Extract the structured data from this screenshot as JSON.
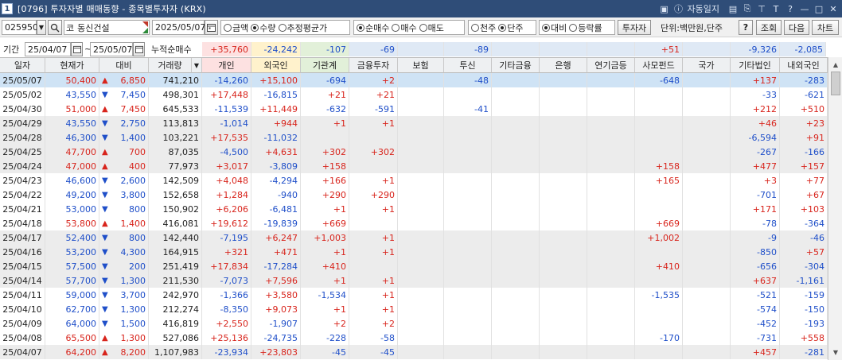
{
  "window": {
    "number": "1",
    "title": "[0796] 투자자별 매매동향 - 종목별투자자 (KRX)",
    "auto_login": "자동일지"
  },
  "toolbar": {
    "code": "025950",
    "market_badge": "코",
    "stock_name": "동신건설",
    "date": "2025/05/07",
    "unit_label": "단위:백만원,단주",
    "help": "?",
    "lookup": "조회",
    "next": "다음",
    "chart": "차트",
    "investor_btn": "투자자",
    "value_radios": [
      {
        "label": "금액",
        "checked": false
      },
      {
        "label": "수량",
        "checked": true
      },
      {
        "label": "추정평균가",
        "checked": false
      }
    ],
    "trade_radios": [
      {
        "label": "순매수",
        "checked": true
      },
      {
        "label": "매수",
        "checked": false
      },
      {
        "label": "매도",
        "checked": false
      }
    ],
    "unit_radios": [
      {
        "label": "천주",
        "checked": false
      },
      {
        "label": "단주",
        "checked": true
      }
    ],
    "compare_radios": [
      {
        "label": "대비",
        "checked": true
      },
      {
        "label": "등락률",
        "checked": false
      }
    ]
  },
  "period": {
    "label": "기간",
    "from": "25/04/07",
    "to": "25/05/07",
    "cum_label": "누적순매수",
    "tilde": "~"
  },
  "cumulative": {
    "개인": "+35,760",
    "외국인": "-24,242",
    "기관계": "-107",
    "금융투자": "-69",
    "보험": "",
    "투신": "-89",
    "기타금융": "",
    "은행": "",
    "연기금등": "",
    "사모펀드": "+51",
    "국가": "",
    "기타법인": "-9,326",
    "내외국인": "-2,085"
  },
  "columns": [
    "일자",
    "현재가",
    "대비",
    "거래량",
    "개인",
    "외국인",
    "기관계",
    "금융투자",
    "보험",
    "투신",
    "기타금융",
    "은행",
    "연기금등",
    "사모펀드",
    "국가",
    "기타법인",
    "내외국인"
  ],
  "rows": [
    {
      "date": "25/05/07",
      "price": "50,400",
      "dir": "up",
      "change": "6,850",
      "volume": "741,210",
      "개인": "-14,260",
      "외국인": "+15,100",
      "기관계": "-694",
      "금융투자": "+2",
      "보험": "",
      "투신": "-48",
      "기타금융": "",
      "은행": "",
      "연기금등": "",
      "사모펀드": "-648",
      "국가": "",
      "기타법인": "+137",
      "내외국인": "-283"
    },
    {
      "date": "25/05/02",
      "price": "43,550",
      "dir": "down",
      "change": "7,450",
      "volume": "498,301",
      "개인": "+17,448",
      "외국인": "-16,815",
      "기관계": "+21",
      "금융투자": "+21",
      "보험": "",
      "투신": "",
      "기타금융": "",
      "은행": "",
      "연기금등": "",
      "사모펀드": "",
      "국가": "",
      "기타법인": "-33",
      "내외국인": "-621"
    },
    {
      "date": "25/04/30",
      "price": "51,000",
      "dir": "up",
      "change": "7,450",
      "volume": "645,533",
      "개인": "-11,539",
      "외국인": "+11,449",
      "기관계": "-632",
      "금융투자": "-591",
      "보험": "",
      "투신": "-41",
      "기타금융": "",
      "은행": "",
      "연기금등": "",
      "사모펀드": "",
      "국가": "",
      "기타법인": "+212",
      "내외국인": "+510"
    },
    {
      "date": "25/04/29",
      "price": "43,550",
      "dir": "down",
      "change": "2,750",
      "volume": "113,813",
      "개인": "-1,014",
      "외국인": "+944",
      "기관계": "+1",
      "금융투자": "+1",
      "보험": "",
      "투신": "",
      "기타금융": "",
      "은행": "",
      "연기금등": "",
      "사모펀드": "",
      "국가": "",
      "기타법인": "+46",
      "내외국인": "+23"
    },
    {
      "date": "25/04/28",
      "price": "46,300",
      "dir": "down",
      "change": "1,400",
      "volume": "103,221",
      "개인": "+17,535",
      "외국인": "-11,032",
      "기관계": "",
      "금융투자": "",
      "보험": "",
      "투신": "",
      "기타금융": "",
      "은행": "",
      "연기금등": "",
      "사모펀드": "",
      "국가": "",
      "기타법인": "-6,594",
      "내외국인": "+91"
    },
    {
      "date": "25/04/25",
      "price": "47,700",
      "dir": "up",
      "change": "700",
      "volume": "87,035",
      "개인": "-4,500",
      "외국인": "+4,631",
      "기관계": "+302",
      "금융투자": "+302",
      "보험": "",
      "투신": "",
      "기타금융": "",
      "은행": "",
      "연기금등": "",
      "사모펀드": "",
      "국가": "",
      "기타법인": "-267",
      "내외국인": "-166"
    },
    {
      "date": "25/04/24",
      "price": "47,000",
      "dir": "up",
      "change": "400",
      "volume": "77,973",
      "개인": "+3,017",
      "외국인": "-3,809",
      "기관계": "+158",
      "금융투자": "",
      "보험": "",
      "투신": "",
      "기타금융": "",
      "은행": "",
      "연기금등": "",
      "사모펀드": "+158",
      "국가": "",
      "기타법인": "+477",
      "내외국인": "+157"
    },
    {
      "date": "25/04/23",
      "price": "46,600",
      "dir": "down",
      "change": "2,600",
      "volume": "142,509",
      "개인": "+4,048",
      "외국인": "-4,294",
      "기관계": "+166",
      "금융투자": "+1",
      "보험": "",
      "투신": "",
      "기타금융": "",
      "은행": "",
      "연기금등": "",
      "사모펀드": "+165",
      "국가": "",
      "기타법인": "+3",
      "내외국인": "+77"
    },
    {
      "date": "25/04/22",
      "price": "49,200",
      "dir": "down",
      "change": "3,800",
      "volume": "152,658",
      "개인": "+1,284",
      "외국인": "-940",
      "기관계": "+290",
      "금융투자": "+290",
      "보험": "",
      "투신": "",
      "기타금융": "",
      "은행": "",
      "연기금등": "",
      "사모펀드": "",
      "국가": "",
      "기타법인": "-701",
      "내외국인": "+67"
    },
    {
      "date": "25/04/21",
      "price": "53,000",
      "dir": "down",
      "change": "800",
      "volume": "150,902",
      "개인": "+6,206",
      "외국인": "-6,481",
      "기관계": "+1",
      "금융투자": "+1",
      "보험": "",
      "투신": "",
      "기타금융": "",
      "은행": "",
      "연기금등": "",
      "사모펀드": "",
      "국가": "",
      "기타법인": "+171",
      "내외국인": "+103"
    },
    {
      "date": "25/04/18",
      "price": "53,800",
      "dir": "up",
      "change": "1,400",
      "volume": "416,081",
      "개인": "+19,612",
      "외국인": "-19,839",
      "기관계": "+669",
      "금융투자": "",
      "보험": "",
      "투신": "",
      "기타금융": "",
      "은행": "",
      "연기금등": "",
      "사모펀드": "+669",
      "국가": "",
      "기타법인": "-78",
      "내외국인": "-364"
    },
    {
      "date": "25/04/17",
      "price": "52,400",
      "dir": "down",
      "change": "800",
      "volume": "142,440",
      "개인": "-7,195",
      "외국인": "+6,247",
      "기관계": "+1,003",
      "금융투자": "+1",
      "보험": "",
      "투신": "",
      "기타금융": "",
      "은행": "",
      "연기금등": "",
      "사모펀드": "+1,002",
      "국가": "",
      "기타법인": "-9",
      "내외국인": "-46"
    },
    {
      "date": "25/04/16",
      "price": "53,200",
      "dir": "down",
      "change": "4,300",
      "volume": "164,915",
      "개인": "+321",
      "외국인": "+471",
      "기관계": "+1",
      "금융투자": "+1",
      "보험": "",
      "투신": "",
      "기타금융": "",
      "은행": "",
      "연기금등": "",
      "사모펀드": "",
      "국가": "",
      "기타법인": "-850",
      "내외국인": "+57"
    },
    {
      "date": "25/04/15",
      "price": "57,500",
      "dir": "down",
      "change": "200",
      "volume": "251,419",
      "개인": "+17,834",
      "외국인": "-17,284",
      "기관계": "+410",
      "금융투자": "",
      "보험": "",
      "투신": "",
      "기타금융": "",
      "은행": "",
      "연기금등": "",
      "사모펀드": "+410",
      "국가": "",
      "기타법인": "-656",
      "내외국인": "-304"
    },
    {
      "date": "25/04/14",
      "price": "57,700",
      "dir": "down",
      "change": "1,300",
      "volume": "211,530",
      "개인": "-7,073",
      "외국인": "+7,596",
      "기관계": "+1",
      "금융투자": "+1",
      "보험": "",
      "투신": "",
      "기타금융": "",
      "은행": "",
      "연기금등": "",
      "사모펀드": "",
      "국가": "",
      "기타법인": "+637",
      "내외국인": "-1,161"
    },
    {
      "date": "25/04/11",
      "price": "59,000",
      "dir": "down",
      "change": "3,700",
      "volume": "242,970",
      "개인": "-1,366",
      "외국인": "+3,580",
      "기관계": "-1,534",
      "금융투자": "+1",
      "보험": "",
      "투신": "",
      "기타금융": "",
      "은행": "",
      "연기금등": "",
      "사모펀드": "-1,535",
      "국가": "",
      "기타법인": "-521",
      "내외국인": "-159"
    },
    {
      "date": "25/04/10",
      "price": "62,700",
      "dir": "down",
      "change": "1,300",
      "volume": "212,274",
      "개인": "-8,350",
      "외국인": "+9,073",
      "기관계": "+1",
      "금융투자": "+1",
      "보험": "",
      "투신": "",
      "기타금융": "",
      "은행": "",
      "연기금등": "",
      "사모펀드": "",
      "국가": "",
      "기타법인": "-574",
      "내외국인": "-150"
    },
    {
      "date": "25/04/09",
      "price": "64,000",
      "dir": "down",
      "change": "1,500",
      "volume": "416,819",
      "개인": "+2,550",
      "외국인": "-1,907",
      "기관계": "+2",
      "금융투자": "+2",
      "보험": "",
      "투신": "",
      "기타금융": "",
      "은행": "",
      "연기금등": "",
      "사모펀드": "",
      "국가": "",
      "기타법인": "-452",
      "내외국인": "-193"
    },
    {
      "date": "25/04/08",
      "price": "65,500",
      "dir": "up",
      "change": "1,300",
      "volume": "527,086",
      "개인": "+25,136",
      "외국인": "-24,735",
      "기관계": "-228",
      "금융투자": "-58",
      "보험": "",
      "투신": "",
      "기타금융": "",
      "은행": "",
      "연기금등": "",
      "사모펀드": "-170",
      "국가": "",
      "기타법인": "-731",
      "내외국인": "+558"
    },
    {
      "date": "25/04/07",
      "price": "64,200",
      "dir": "up",
      "change": "8,200",
      "volume": "1,107,983",
      "개인": "-23,934",
      "외국인": "+23,803",
      "기관계": "-45",
      "금융투자": "-45",
      "보험": "",
      "투신": "",
      "기타금융": "",
      "은행": "",
      "연기금등": "",
      "사모펀드": "",
      "국가": "",
      "기타법인": "+457",
      "내외국인": "-281"
    }
  ],
  "colors": {
    "up": "#d8241c",
    "down": "#1f4fc9",
    "selected_row": "#cfe3f5",
    "zebra": "#ececec",
    "indiv_header": "#fde1e1",
    "foreign_header": "#fff2cc",
    "inst_header": "#e2f0d9",
    "title_bar": "#2f4d78"
  }
}
